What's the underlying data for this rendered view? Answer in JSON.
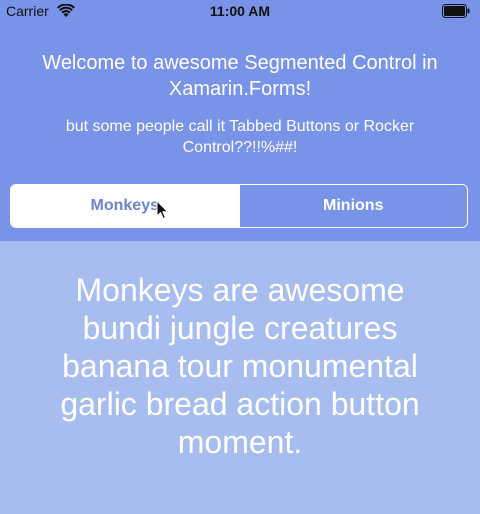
{
  "status_bar": {
    "carrier": "Carrier",
    "time": "11:00 AM"
  },
  "header": {
    "title": "Welcome to awesome Segmented Control in Xamarin.Forms!",
    "subtitle": "but some people call it Tabbed Buttons or Rocker Control??!!%##!"
  },
  "segmented_control": {
    "segments": [
      {
        "label": "Monkeys",
        "selected": true
      },
      {
        "label": "Minions",
        "selected": false
      }
    ]
  },
  "content": {
    "text": "Monkeys are awesome bundi jungle creatures banana tour monumental garlic bread action button moment."
  },
  "colors": {
    "header_bg": "#7893e8",
    "content_bg": "#a7bdf0",
    "selected_text": "#6d84cd"
  },
  "icons": {
    "wifi": "wifi-icon",
    "battery": "battery-icon",
    "cursor": "mouse-cursor-icon"
  }
}
